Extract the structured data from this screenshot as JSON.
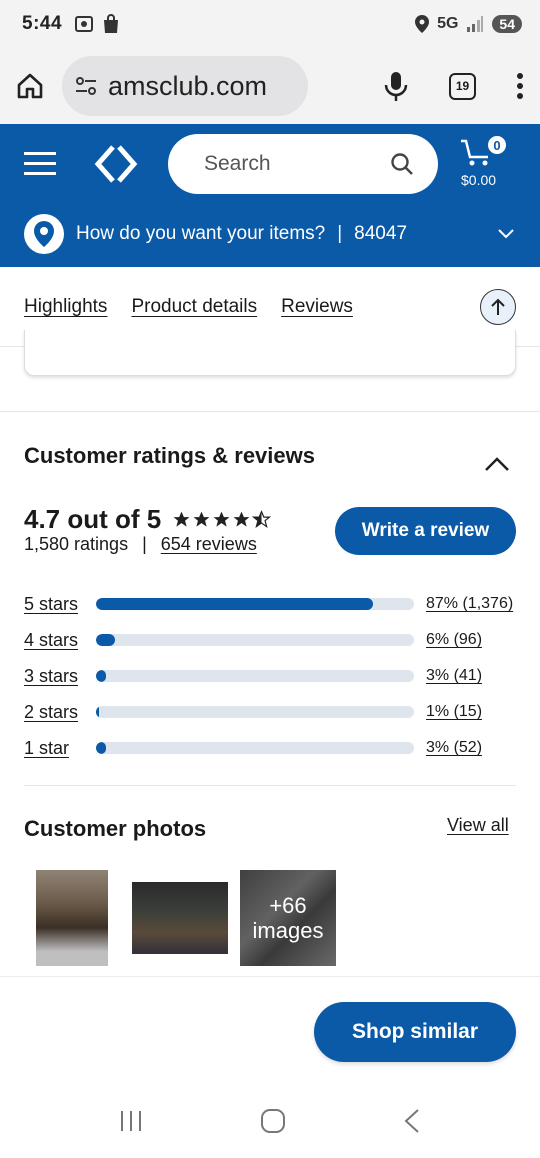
{
  "status_bar": {
    "time": "5:44",
    "network": "5G",
    "battery": "54"
  },
  "browser": {
    "url": "amsclub.com",
    "tab_count": "19"
  },
  "header": {
    "search_placeholder": "Search",
    "cart_count": "0",
    "cart_total": "$0.00",
    "location_prompt": "How do you want your items?",
    "location_separator": "|",
    "zip": "84047",
    "brand_color": "#0b5aa8"
  },
  "tabs": [
    {
      "label": "Highlights"
    },
    {
      "label": "Product details"
    },
    {
      "label": "Reviews"
    }
  ],
  "ratings": {
    "title": "Customer ratings & reviews",
    "average": "4.7 out of 5",
    "stars_value": 4.7,
    "ratings_count": "1,580 ratings",
    "separator": "|",
    "reviews_count": "654 reviews",
    "write_review_label": "Write a review",
    "distribution": [
      {
        "label": "5 stars",
        "value": "87% (1,376)",
        "percent": 87
      },
      {
        "label": "4 stars",
        "value": "6% (96)",
        "percent": 6
      },
      {
        "label": "3 stars",
        "value": "3% (41)",
        "percent": 3
      },
      {
        "label": "2 stars",
        "value": "1% (15)",
        "percent": 1
      },
      {
        "label": "1 star",
        "value": "3% (52)",
        "percent": 3
      }
    ]
  },
  "photos": {
    "title": "Customer photos",
    "view_all_label": "View all",
    "more_count": "+66",
    "more_label": "images"
  },
  "shop_similar_label": "Shop similar"
}
